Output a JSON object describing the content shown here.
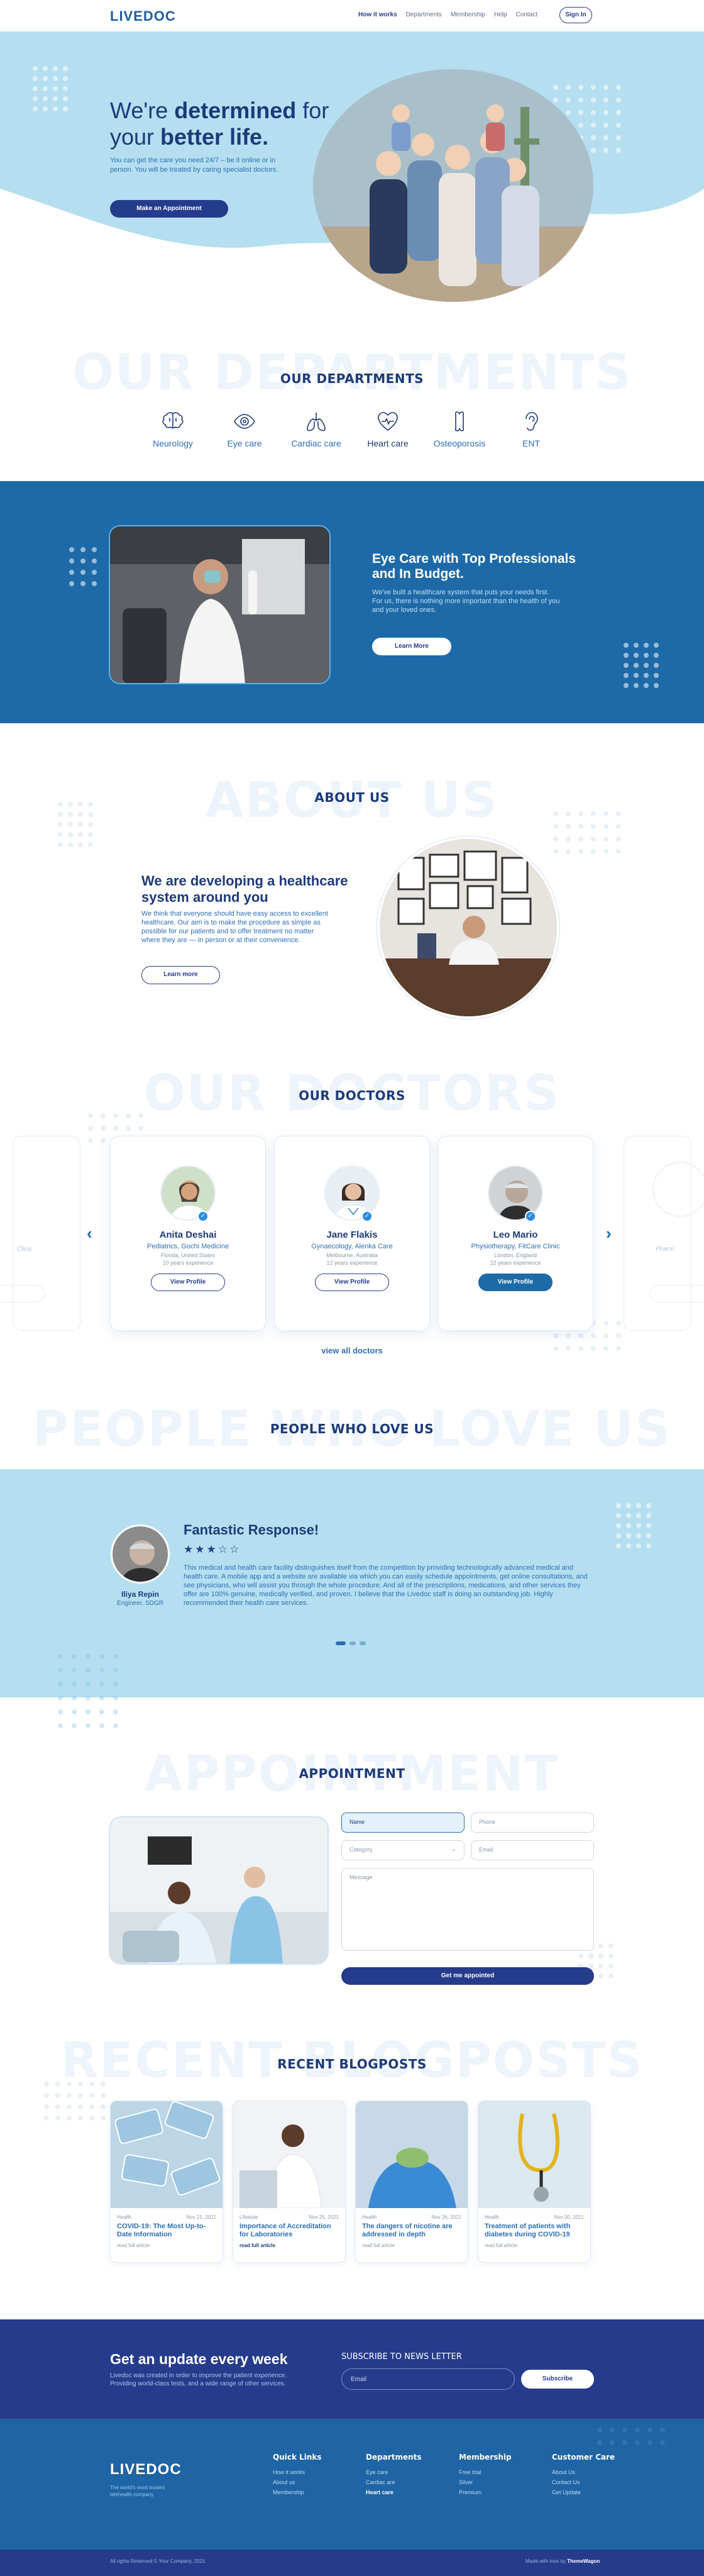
{
  "header": {
    "logo": "LIVEDOC",
    "nav": [
      "How it works",
      "Departments",
      "Membership",
      "Help",
      "Contact"
    ],
    "signin": "Sign In"
  },
  "hero": {
    "title_a": "We're ",
    "title_b": "determined",
    "title_c": " for your ",
    "title_d": "better life.",
    "subtitle": "You can get the care you need 24/7 – be it online or in person. You will be treated by caring specialist doctors.",
    "button": "Make an Appointment"
  },
  "departments": {
    "watermark": "OUR DEPARTMENTS",
    "title": "OUR DEPARTMENTS",
    "items": [
      {
        "label": "Neurology",
        "icon": "brain-icon"
      },
      {
        "label": "Eye care",
        "icon": "eye-icon"
      },
      {
        "label": "Cardiac care",
        "icon": "lungs-icon"
      },
      {
        "label": "Heart care",
        "icon": "heart-icon"
      },
      {
        "label": "Osteoporosis",
        "icon": "bone-icon"
      },
      {
        "label": "ENT",
        "icon": "ear-icon"
      }
    ]
  },
  "eyecare": {
    "title": "Eye Care with Top Professionals and In Budget.",
    "text": "We've built a healthcare system that puts your needs first. For us, there is nothing more important than the health of you and your loved ones.",
    "button": "Learn More"
  },
  "about": {
    "watermark": "ABOUT US",
    "title": "ABOUT US",
    "heading": "We are developing a healthcare system around you",
    "text": "We think that everyone should have easy access to excellent healthcare. Our aim is to make the procedure as simple as possible for our patients and to offer treatment no matter where they are — in person or at their convenience.",
    "button": "Learn more"
  },
  "doctors": {
    "watermark": "OUR DOCTORS",
    "title": "OUR DOCTORS",
    "ghost_left": "Clinic",
    "ghost_right": "Pharm",
    "items": [
      {
        "name": "Anita Deshai",
        "specialty": "Pediatrics, Gochi Medicine",
        "location": "Florida, United States",
        "experience": "10 years experience",
        "button": "View Profile"
      },
      {
        "name": "Jane Flakis",
        "specialty": "Gynaecology, Alenka Care",
        "location": "Melbourne, Australia",
        "experience": "12 years experience",
        "button": "View Profile"
      },
      {
        "name": "Leo Mario",
        "specialty": "Physiotherapy, FitCare Clinic",
        "location": "London, England",
        "experience": "22 years experience",
        "button": "View Profile"
      }
    ],
    "view_all": "view all doctors"
  },
  "testimonials": {
    "watermark": "PEOPLE WHO LOVE US",
    "title": "PEOPLE WHO LOVE US",
    "name": "Iliya Repin",
    "role": "Engineer, SDGR",
    "headline": "Fantastic Response!",
    "rating": 3.5,
    "stars": "★★★☆☆",
    "text": "This medical and health care facility distinguishes itself from the competition by providing technologically advanced medical and health care. A mobile app and a website are available via which you can easily schedule appointments, get online consultations, and see physicians, who will assist you through the whole procedure. And all of the prescriptions, medications, and other services they offer are 100% genuine, medically verified, and proven. I believe that the Livedoc staff is doing an outstanding job. Highly recommended their health care services."
  },
  "appointment": {
    "watermark": "APPOINTMENT",
    "title": "APPOINTMENT",
    "name_placeholder": "Name",
    "phone_placeholder": "Phone",
    "category_placeholder": "Category",
    "email_placeholder": "Email",
    "message_placeholder": "Message",
    "button": "Get me appointed"
  },
  "blog": {
    "watermark": "RECENT BLOGPOSTS",
    "title": "RECENT BLOGPOSTS",
    "items": [
      {
        "category": "Health",
        "date": "Nov 21, 2021",
        "title": "COVID-19: The Most Up-to-Date Information",
        "more": "read full article"
      },
      {
        "category": "Lifestyle",
        "date": "Nov 25, 2021",
        "title": "Importance of Accreditation for Laboratories",
        "more": "read full article"
      },
      {
        "category": "Health",
        "date": "Nov 26, 2021",
        "title": "The dangers of nicotine are addressed in depth",
        "more": "read full article"
      },
      {
        "category": "Health",
        "date": "Nov 30, 2021",
        "title": "Treatment of patients with diabetes during COVID-19",
        "more": "read full article"
      }
    ]
  },
  "newsletter": {
    "title": "Get an update every week",
    "text": "Livedoc was created in order to improve the patient experience. Providing world-class tests, and a wide range of other services.",
    "label": "SUBSCRIBE TO NEWS LETTER",
    "email_placeholder": "Email",
    "button": "Subscribe"
  },
  "footer": {
    "logo": "LIVEDOC",
    "tagline": "The world's most trusted telehealth company.",
    "columns": [
      {
        "heading": "Quick Links",
        "items": [
          "How it works",
          "About us",
          "Membership"
        ]
      },
      {
        "heading": "Departments",
        "items": [
          "Eye care",
          "Cardiac are",
          "Heart care"
        ]
      },
      {
        "heading": "Membership",
        "items": [
          "Free trial",
          "Silver",
          "Premium"
        ]
      },
      {
        "heading": "Customer Care",
        "items": [
          "About Us",
          "Contact Us",
          "Get Update"
        ]
      }
    ],
    "copyright": "All rights Reserved © Your Company, 2021",
    "credit_prefix": "Made with love by ",
    "credit_name": "ThemeWagon"
  },
  "colors": {
    "primary": "#253b8c",
    "accent": "#1e6aa8",
    "light": "#b5dff0"
  }
}
